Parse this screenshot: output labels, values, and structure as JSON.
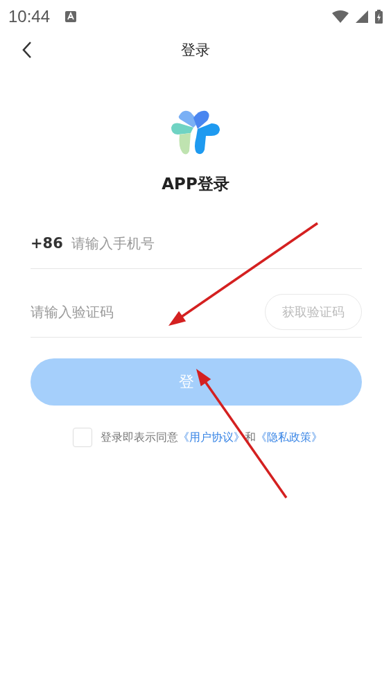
{
  "status_bar": {
    "time": "10:44"
  },
  "nav": {
    "title": "登录"
  },
  "app_title": "APP登录",
  "phone_field": {
    "prefix": "+86",
    "placeholder": "请输入手机号"
  },
  "code_field": {
    "placeholder": "请输入验证码",
    "button": {
      "label": "获取验证码",
      "disabled": true
    }
  },
  "login_button": {
    "label": "登",
    "disabled": true
  },
  "agreement": {
    "checked": false,
    "text": "登录即表示同意",
    "link_1": "《用户协议》",
    "joiner": "和",
    "link_2": "《隐私政策》"
  },
  "annotations": [
    {
      "kind": "arrow"
    },
    {
      "kind": "arrow"
    }
  ]
}
